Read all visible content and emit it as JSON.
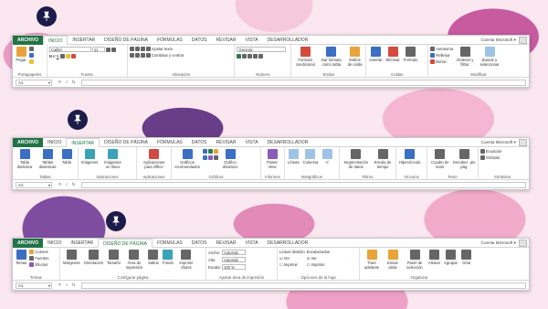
{
  "account": "Cuenta Microsoft",
  "namebox": "A1",
  "fx_icons": [
    "✕",
    "✓",
    "fx"
  ],
  "accent_color": "#217346",
  "tabs": [
    "ARCHIVO",
    "INICIO",
    "INSERTAR",
    "DISEÑO DE PÁGINA",
    "FÓRMULAS",
    "DATOS",
    "REVISAR",
    "VISTA",
    "DESARROLLADOR"
  ],
  "win1": {
    "groups": {
      "portapapeles": "Portapapeles",
      "fuente": "Fuente",
      "alineacion": "Alineación",
      "numero": "Número",
      "estilos": "Estilos",
      "celdas": "Celdas",
      "modificar": "Modificar"
    },
    "pegar": "Pegar",
    "font_name": "Calibri",
    "font_size": "11",
    "ajustar_texto": "Ajustar texto",
    "combinar": "Combinar y centrar",
    "number_format": "General",
    "formato_condicional": "Formato condicional",
    "dar_formato": "Dar formato como tabla",
    "estilos_celda": "Estilos de celda",
    "insertar": "Insertar",
    "eliminar": "Eliminar",
    "formato": "Formato",
    "autosuma": "Autosuma",
    "rellenar": "Rellenar",
    "borrar": "Borrar",
    "ordenar": "Ordenar y filtrar",
    "buscar": "Buscar y seleccionar"
  },
  "win2": {
    "groups": {
      "tablas": "Tablas",
      "ilustraciones": "Ilustraciones",
      "aplicaciones": "Aplicaciones",
      "graficos": "Gráficos",
      "informes": "Informes",
      "minigraficos": "Minigráficos",
      "filtros": "Filtros",
      "vinculos": "Vínculos",
      "texto": "Texto",
      "simbolos": "Símbolos"
    },
    "tabla_dinamica": "Tabla dinámica",
    "tablas_recomendadas": "Tablas dinámicas",
    "tabla": "Tabla",
    "imagenes": "Imágenes",
    "imagenes_linea": "Imágenes en línea",
    "apps": "Aplicaciones para Office",
    "graficos_rec": "Gráficos recomendados",
    "grafico_dinamico": "Gráfico dinámico",
    "power_view": "Power View",
    "lineas": "Líneas",
    "columna": "Columna",
    "ganancia": "+/-",
    "segmentacion": "Segmentación de datos",
    "escala": "Escala de tiempo",
    "hipervinculo": "Hipervínculo",
    "cuadro_texto": "Cuadro de texto",
    "encabezado": "Encabez. pie pág.",
    "ecuacion": "Ecuación",
    "simbolo": "Símbolo"
  },
  "win3": {
    "groups": {
      "temas": "Temas",
      "configurar": "Configurar página",
      "ajustar": "Ajustar área de impresión",
      "opciones": "Opciones de la hoja",
      "organizar": "Organizar"
    },
    "temas": "Temas",
    "colores": "Colores",
    "fuentes": "Fuentes",
    "efectos": "Efectos",
    "margenes": "Márgenes",
    "orientacion": "Orientación",
    "tamano": "Tamaño",
    "area": "Área de impresión",
    "saltos": "Saltos",
    "fondo": "Fondo",
    "imprimir_titulos": "Imprimir títulos",
    "ancho": "Ancho:",
    "alto": "Alto:",
    "escala": "Escala:",
    "auto": "Automát.",
    "pct": "100 %",
    "lineas_div": "Líneas división",
    "encabezados": "Encabezados",
    "ver": "Ver",
    "imprimir": "Imprimir",
    "traer": "Traer adelante",
    "enviar": "Enviar atrás",
    "panel": "Panel de selección",
    "alinear": "Alinear",
    "agrupar": "Agrupar",
    "girar": "Girar"
  }
}
